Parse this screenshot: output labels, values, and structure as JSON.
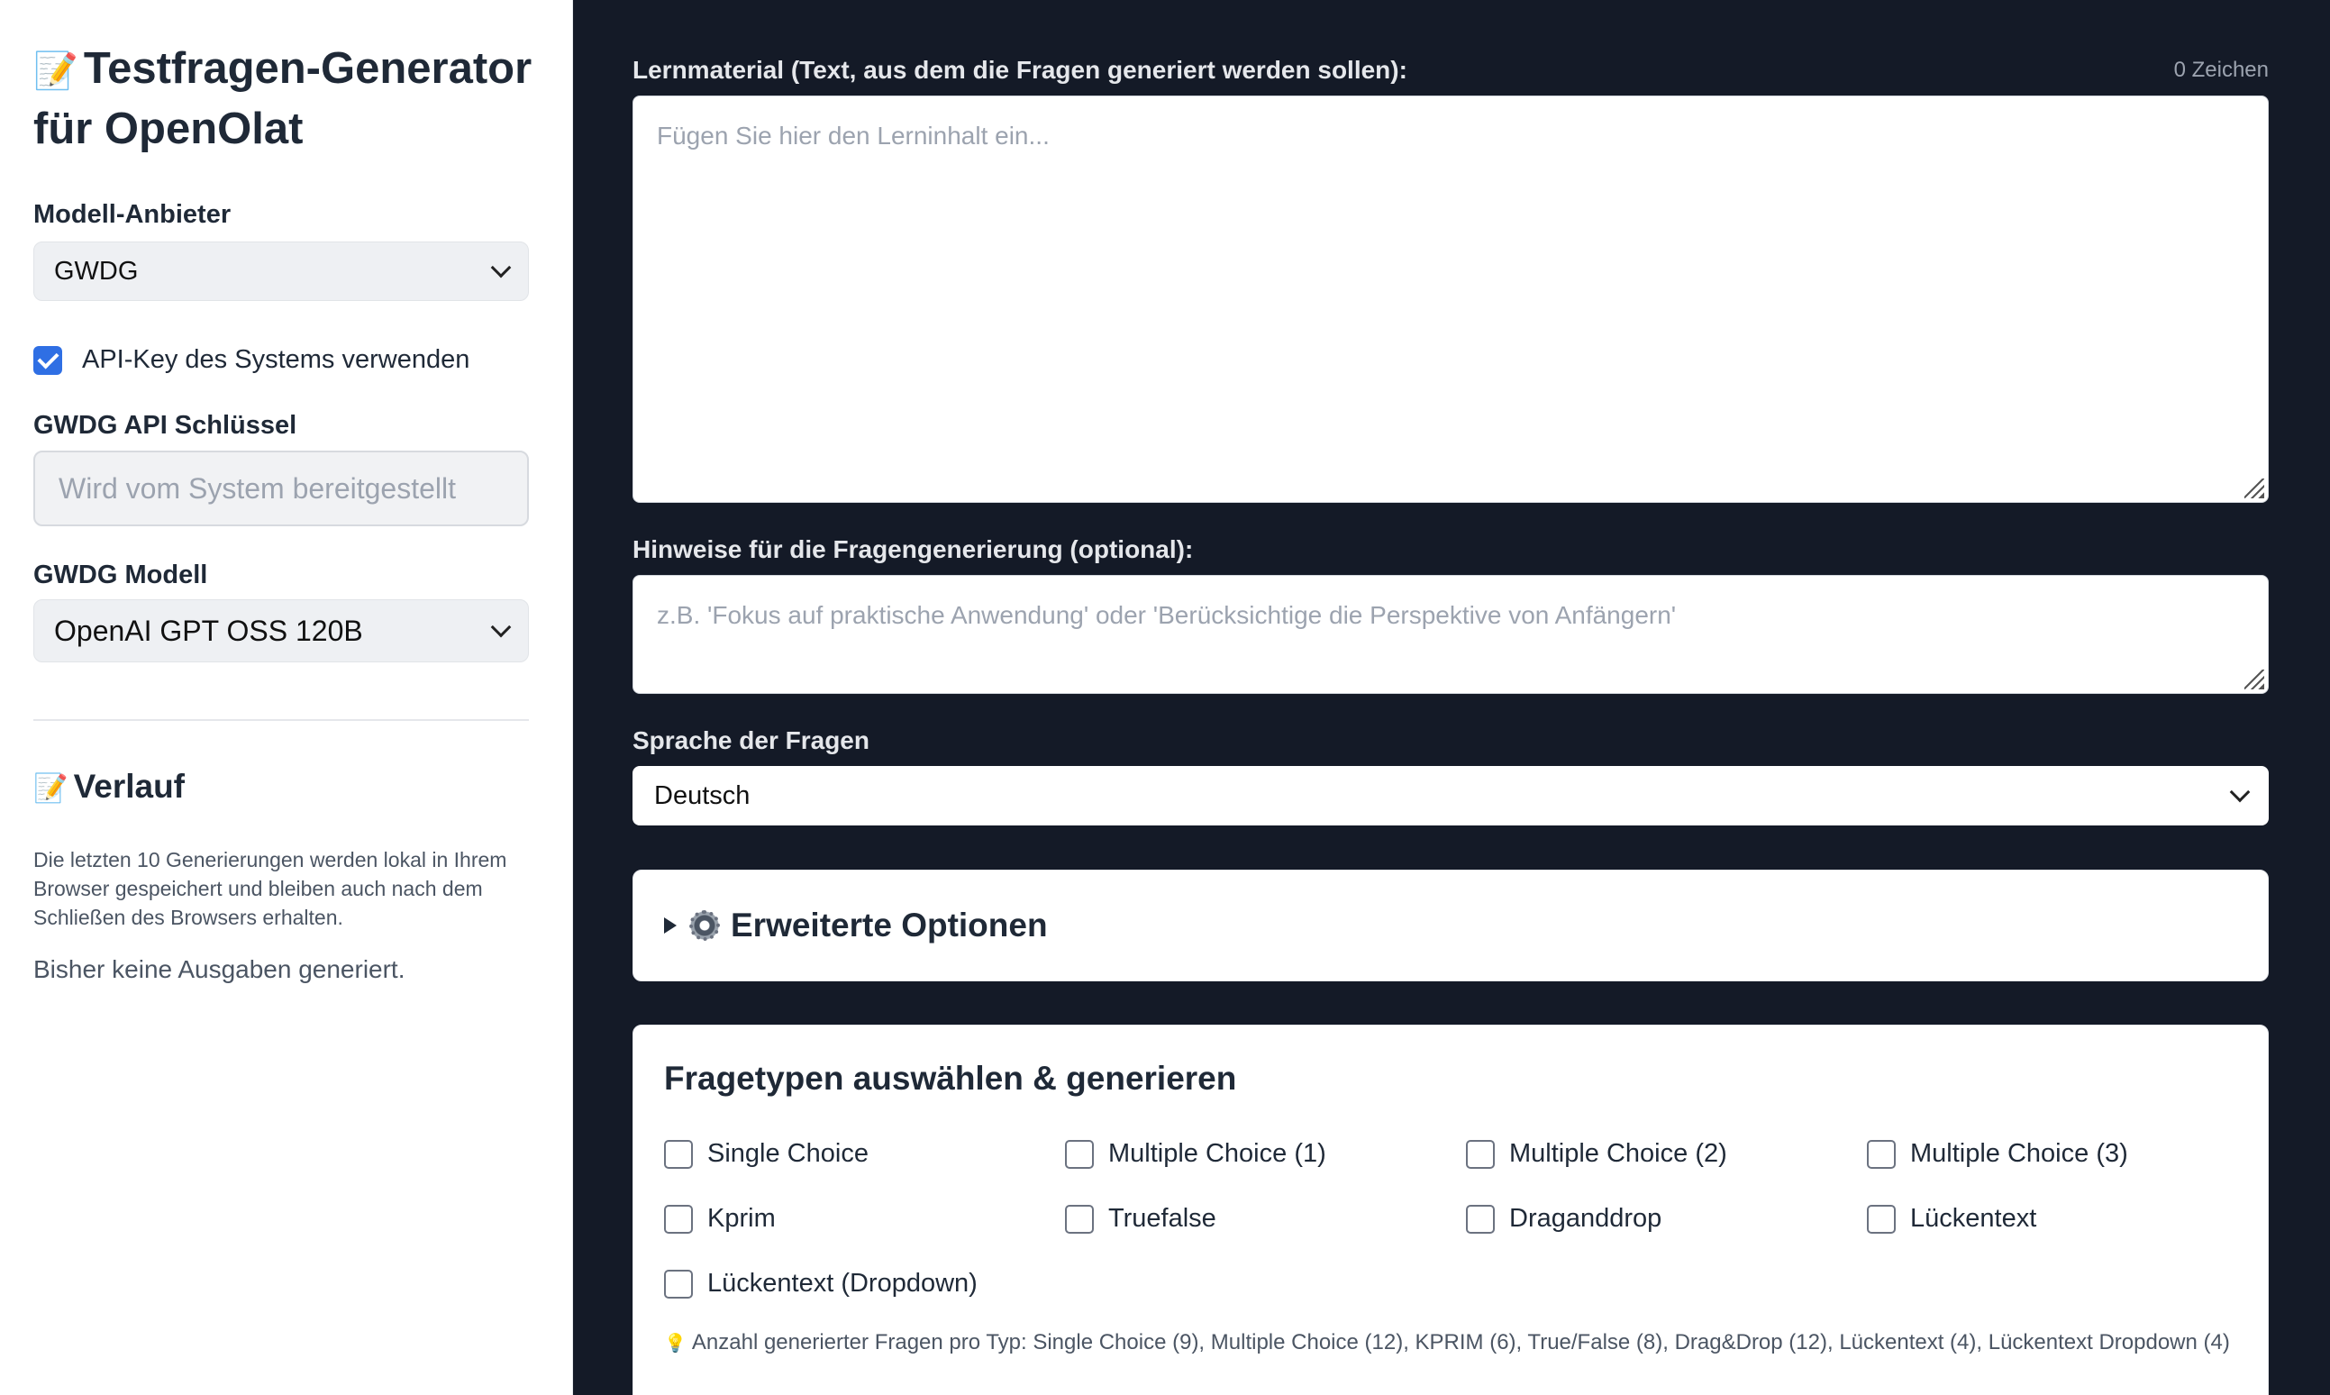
{
  "sidebar": {
    "title_emoji": "📝",
    "title": "Testfragen-Generator für OpenOlat",
    "provider_label": "Modell-Anbieter",
    "provider_value": "GWDG",
    "use_system_key_label": "API-Key des Systems verwenden",
    "use_system_key_checked": true,
    "api_key_label": "GWDG API Schlüssel",
    "api_key_placeholder": "Wird vom System bereitgestellt",
    "model_label": "GWDG Modell",
    "model_value": "OpenAI GPT OSS 120B",
    "history_emoji": "📝",
    "history_title": "Verlauf",
    "history_description": "Die letzten 10 Generierungen werden lokal in Ihrem Browser gespeichert und bleiben auch nach dem Schließen des Browsers erhalten.",
    "history_empty": "Bisher keine Ausgaben generiert."
  },
  "main": {
    "material_label": "Lernmaterial (Text, aus dem die Fragen generiert werden sollen):",
    "char_count": "0 Zeichen",
    "material_placeholder": "Fügen Sie hier den Lerninhalt ein...",
    "hints_label": "Hinweise für die Fragengenerierung (optional):",
    "hints_placeholder": "z.B. 'Fokus auf praktische Anwendung' oder 'Berücksichtige die Perspektive von Anfängern'",
    "language_label": "Sprache der Fragen",
    "language_value": "Deutsch",
    "advanced_title": "Erweiterte Optionen",
    "types_title": "Fragetypen auswählen & generieren",
    "question_types": [
      "Single Choice",
      "Multiple Choice (1)",
      "Multiple Choice (2)",
      "Multiple Choice (3)",
      "Kprim",
      "Truefalse",
      "Draganddrop",
      "Lückentext",
      "Lückentext (Dropdown)"
    ],
    "types_note_icon": "💡",
    "types_note": "Anzahl generierter Fragen pro Typ: Single Choice (9), Multiple Choice (12), KPRIM (6), True/False (8), Drag&Drop (12), Lückentext (4), Lückentext Dropdown (4)"
  },
  "colors": {
    "main_background": "#141a27",
    "sidebar_background": "#ffffff",
    "accent_blue": "#2f6fe4"
  }
}
